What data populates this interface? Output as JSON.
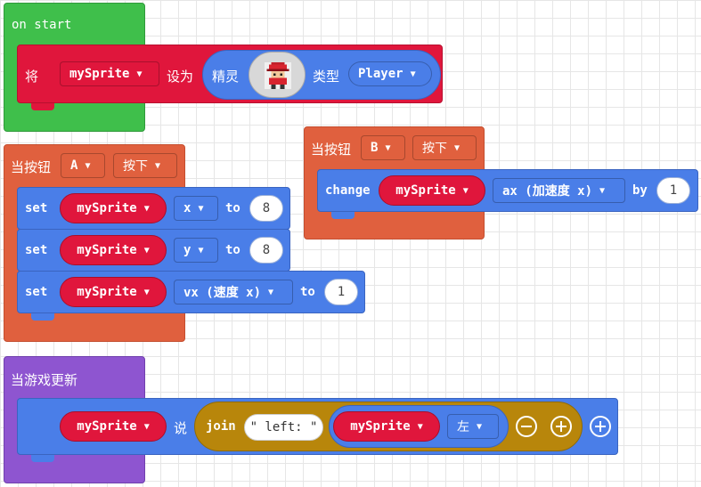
{
  "workspace": {
    "on_start": {
      "label": "on start",
      "set_prefix": "将",
      "variable": "mySprite",
      "set_to": "设为",
      "sprite_label": "精灵",
      "kind_label": "类型",
      "kind_value": "Player"
    },
    "on_button_a": {
      "label": "当按钮",
      "button": "A",
      "event": "按下",
      "rows": [
        {
          "set": "set",
          "variable": "mySprite",
          "property": "x",
          "to": "to",
          "value": "8"
        },
        {
          "set": "set",
          "variable": "mySprite",
          "property": "y",
          "to": "to",
          "value": "8"
        },
        {
          "set": "set",
          "variable": "mySprite",
          "property": "vx (速度 x)",
          "to": "to",
          "value": "1"
        }
      ]
    },
    "on_button_b": {
      "label": "当按钮",
      "button": "B",
      "event": "按下",
      "change": "change",
      "variable": "mySprite",
      "property": "ax (加速度 x)",
      "by": "by",
      "value": "1"
    },
    "on_game_update": {
      "label": "当游戏更新",
      "variable": "mySprite",
      "say": "说",
      "join": "join",
      "text": "\" left: \"",
      "inner_variable": "mySprite",
      "inner_property": "左",
      "minus": "⊖",
      "plus": "⊕",
      "plus_outer": "⊕"
    }
  },
  "colors": {
    "loops_green": "#3fbf4b",
    "controller_orange": "#e0603e",
    "game_purple": "#8e55d0",
    "sprites_blue": "#4a7ee8",
    "variable_red": "#e0163c",
    "text_gold": "#b8860b"
  },
  "icons": {
    "sprite_image": "pixel-player-sprite",
    "dropdown": "caret-down-icon"
  }
}
